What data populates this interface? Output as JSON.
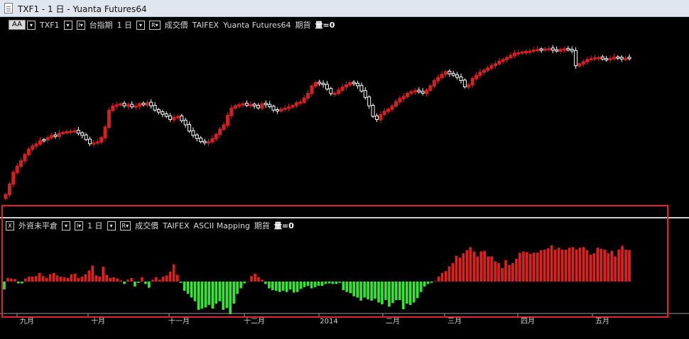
{
  "window": {
    "title": "TXF1 - 1 日 - Yuanta Futures64"
  },
  "price_panel": {
    "aa_button": "AA",
    "symbol": "TXF1",
    "index_name": "台指期",
    "period": "1 日",
    "r_button": "R",
    "price_type": "成交價",
    "exchange": "TAIFEX",
    "source": "Yuanta Futures64",
    "category": "期貨",
    "volume_label": "量=0"
  },
  "indicator_panel": {
    "close_button": "X",
    "name": "外資未平倉",
    "period": "1 日",
    "r_button": "R",
    "price_type": "成交價",
    "exchange": "TAIFEX",
    "source": "ASCII Mapping",
    "category": "期貨",
    "volume_label": "量=0"
  },
  "x_axis": {
    "labels": [
      "九月",
      "十月",
      "十一月",
      "十二月",
      "2014",
      "二月",
      "三月",
      "四月",
      "五月"
    ]
  },
  "colors": {
    "up_candle": "#d42020",
    "down_candle": "#ffffff",
    "positive_bar": "#e0201e",
    "negative_bar": "#2fe82f",
    "highlight_box": "#e0242c"
  },
  "chart_data": [
    {
      "type": "candlestick",
      "series": [
        {
          "closes": [
            7880,
            7930,
            7985,
            8015,
            8040,
            8070,
            8095,
            8110,
            8120,
            8135,
            8140,
            8150,
            8160,
            8155,
            8170,
            8175,
            8178,
            8180,
            8182,
            8170,
            8160,
            8140,
            8120,
            8125,
            8130,
            8150,
            8200,
            8280,
            8300,
            8305,
            8310,
            8300,
            8305,
            8295,
            8300,
            8310,
            8305,
            8315,
            8300,
            8280,
            8270,
            8260,
            8250,
            8235,
            8245,
            8250,
            8230,
            8210,
            8180,
            8160,
            8145,
            8130,
            8125,
            8130,
            8145,
            8165,
            8190,
            8210,
            8255,
            8290,
            8300,
            8305,
            8310,
            8302,
            8306,
            8300,
            8290,
            8310,
            8305,
            8296,
            8280,
            8276,
            8285,
            8290,
            8295,
            8302,
            8315,
            8318,
            8338,
            8360,
            8395,
            8410,
            8405,
            8400,
            8380,
            8358,
            8360,
            8375,
            8390,
            8400,
            8410,
            8405,
            8395,
            8370,
            8340,
            8300,
            8250,
            8235,
            8260,
            8275,
            8285,
            8300,
            8320,
            8335,
            8345,
            8360,
            8368,
            8372,
            8366,
            8360,
            8375,
            8395,
            8420,
            8435,
            8450,
            8462,
            8452,
            8445,
            8435,
            8420,
            8390,
            8400,
            8430,
            8445,
            8460,
            8470,
            8480,
            8492,
            8500,
            8512,
            8520,
            8530,
            8540,
            8550,
            8552,
            8556,
            8558,
            8560,
            8565,
            8568,
            8565,
            8570,
            8572,
            8564,
            8560,
            8568,
            8570,
            8566,
            8560,
            8490,
            8500,
            8510,
            8520,
            8525,
            8528,
            8530,
            8522,
            8520,
            8525,
            8530,
            8528,
            8522,
            8525,
            8530
          ],
          "bullish": [
            true,
            true,
            true,
            true,
            true,
            true,
            true,
            true,
            true,
            true,
            false,
            true,
            true,
            false,
            true,
            true,
            true,
            true,
            true,
            false,
            false,
            false,
            false,
            true,
            true,
            true,
            true,
            true,
            true,
            true,
            true,
            false,
            true,
            false,
            true,
            true,
            false,
            true,
            false,
            false,
            false,
            false,
            false,
            false,
            true,
            true,
            false,
            false,
            false,
            false,
            false,
            false,
            false,
            true,
            true,
            true,
            true,
            true,
            true,
            true,
            true,
            true,
            true,
            false,
            true,
            false,
            false,
            true,
            false,
            false,
            false,
            false,
            true,
            true,
            true,
            true,
            true,
            true,
            true,
            true,
            true,
            true,
            false,
            false,
            false,
            false,
            true,
            true,
            true,
            true,
            true,
            false,
            false,
            false,
            false,
            false,
            false,
            false,
            true,
            true,
            true,
            true,
            true,
            true,
            true,
            true,
            true,
            true,
            false,
            false,
            true,
            true,
            true,
            true,
            true,
            true,
            false,
            false,
            false,
            false,
            false,
            true,
            true,
            true,
            true,
            true,
            true,
            true,
            true,
            true,
            true,
            true,
            true,
            true,
            true,
            true,
            true,
            true,
            true,
            true,
            false,
            true,
            true,
            false,
            false,
            true,
            true,
            false,
            false,
            false,
            true,
            true,
            true,
            true,
            true,
            true,
            false,
            false,
            true,
            true,
            false,
            false,
            true,
            false
          ]
        }
      ]
    },
    {
      "type": "bar",
      "series": [
        {
          "values": [
            -13,
            6,
            5,
            4,
            -3,
            -3,
            5,
            8,
            8,
            9,
            14,
            9,
            6,
            12,
            14,
            10,
            8,
            7,
            6,
            12,
            13,
            6,
            8,
            12,
            18,
            26,
            10,
            8,
            24,
            11,
            6,
            7,
            5,
            2,
            -4,
            3,
            6,
            -8,
            -2,
            7,
            -4,
            -10,
            3,
            7,
            3,
            8,
            10,
            16,
            28,
            11,
            -2,
            -15,
            -20,
            -26,
            -32,
            -46,
            -44,
            -42,
            -38,
            -44,
            -36,
            -32,
            -46,
            -43,
            -53,
            -36,
            -20,
            -11,
            -3,
            0,
            9,
            13,
            7,
            3,
            -4,
            -11,
            -14,
            -15,
            -17,
            -15,
            -17,
            -13,
            -18,
            -17,
            -12,
            -9,
            -7,
            -11,
            -9,
            -7,
            -7,
            -4,
            -3,
            -4,
            -4,
            -2,
            -14,
            -17,
            -19,
            -24,
            -26,
            -31,
            -26,
            -29,
            -31,
            -28,
            -34,
            -37,
            -30,
            -41,
            -35,
            -30,
            -30,
            -45,
            -36,
            -38,
            -34,
            -27,
            -17,
            -8,
            -4,
            -2,
            1,
            8,
            14,
            17,
            25,
            30,
            42,
            39,
            46,
            51,
            56,
            49,
            41,
            49,
            50,
            41,
            41,
            33,
            30,
            22,
            35,
            27,
            30,
            37,
            47,
            49,
            48,
            45,
            47,
            47,
            51,
            52,
            54,
            59,
            52,
            55,
            52,
            52,
            55,
            56,
            52,
            55,
            56,
            51,
            44,
            46,
            55,
            53,
            52,
            46,
            50,
            41,
            52,
            58,
            52,
            51
          ]
        }
      ]
    }
  ]
}
